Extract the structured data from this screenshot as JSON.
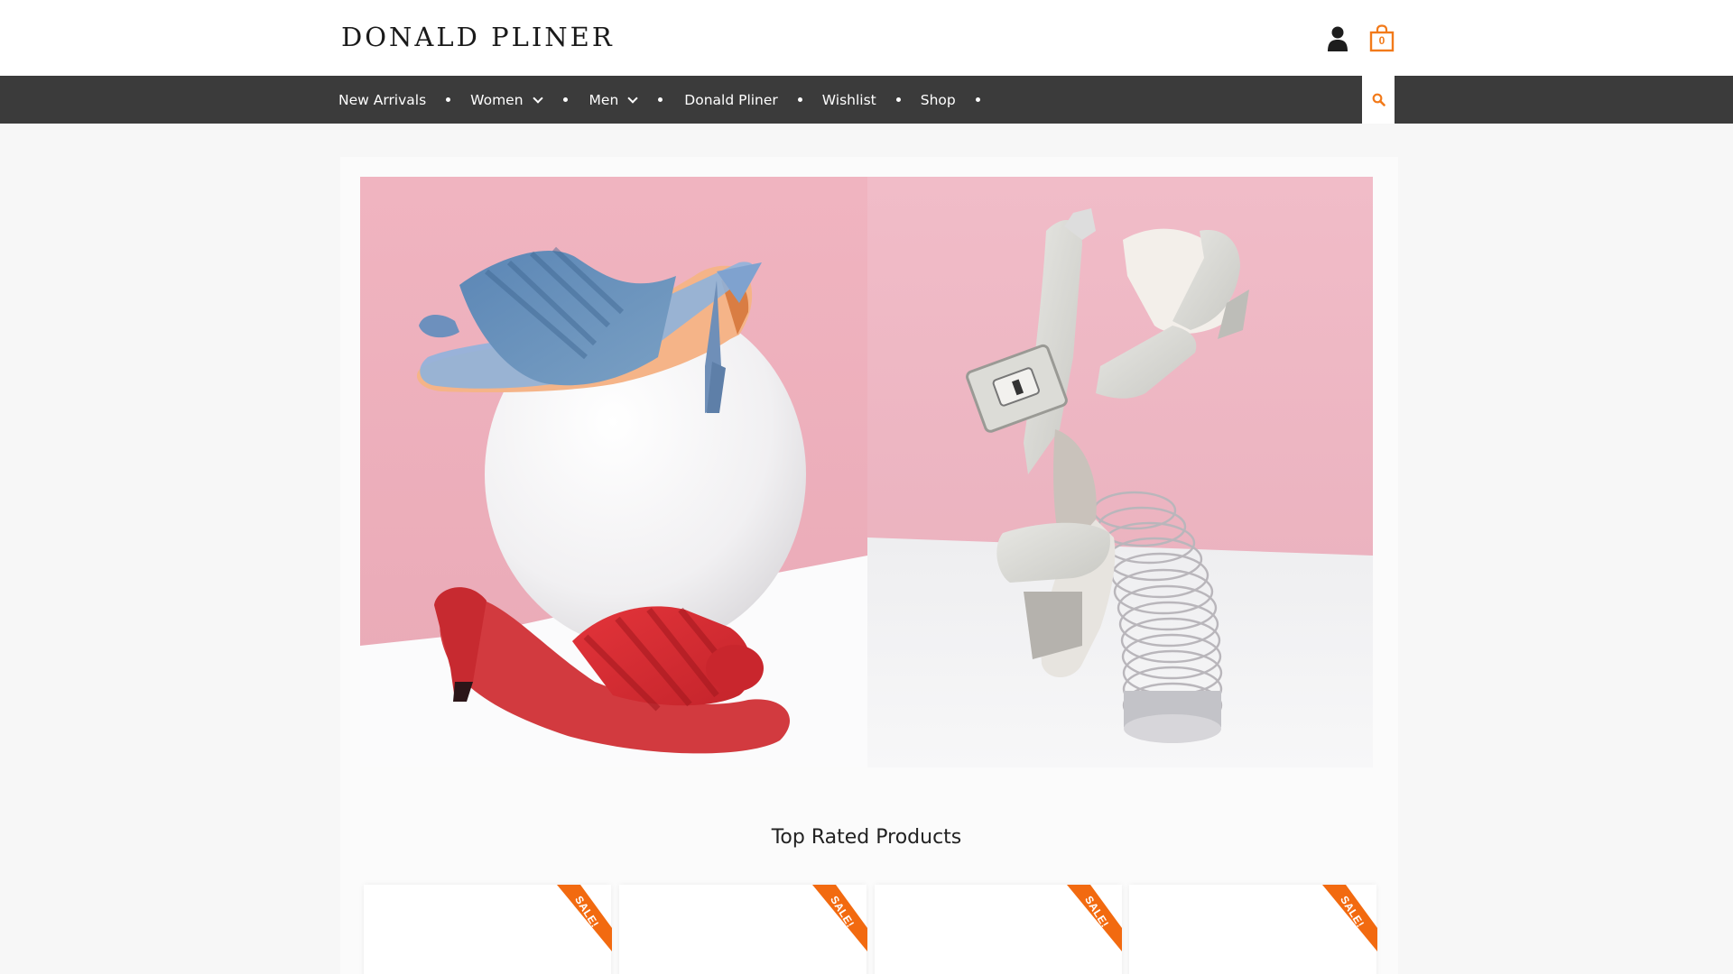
{
  "header": {
    "logo": "DONALD PLINER",
    "cart_count": "0"
  },
  "nav": {
    "items": [
      {
        "label": "New Arrivals"
      },
      {
        "label": "Women"
      },
      {
        "label": "Men"
      },
      {
        "label": "Donald Pliner"
      },
      {
        "label": "Wishlist"
      },
      {
        "label": "Shop"
      }
    ]
  },
  "icons": {
    "user": "user-icon",
    "cart": "shopping-bag-icon",
    "search": "search-icon"
  },
  "colors": {
    "accent": "#f27a1a",
    "nav_bg": "#3b3b3b",
    "ribbon": "#f26a10"
  },
  "main": {
    "section_title": "Top Rated Products",
    "products": [
      {
        "badge": "SALE!"
      },
      {
        "badge": "SALE!"
      },
      {
        "badge": "SALE!"
      },
      {
        "badge": "SALE!"
      }
    ]
  }
}
